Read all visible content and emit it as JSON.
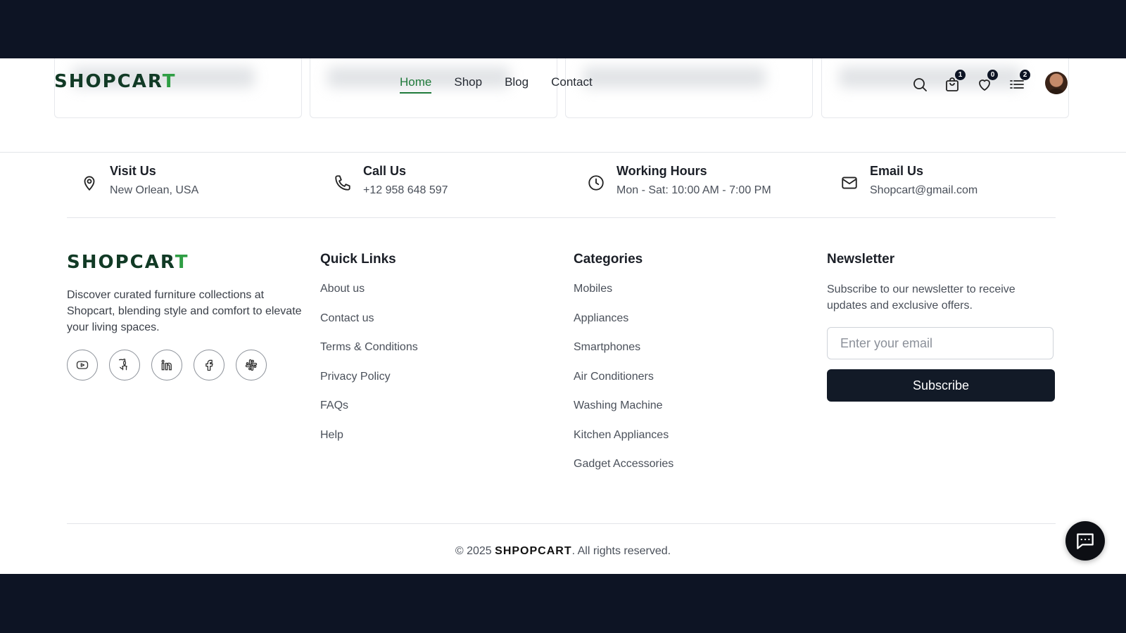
{
  "header": {
    "logo_main": "SHOPCAR",
    "logo_accent": "T",
    "nav": [
      "Home",
      "Shop",
      "Blog",
      "Contact"
    ],
    "active_nav": "Home",
    "badges": {
      "cart": "1",
      "wishlist": "0",
      "compare": "2"
    }
  },
  "contact": {
    "visit": {
      "title": "Visit Us",
      "text": "New Orlean, USA"
    },
    "call": {
      "title": "Call Us",
      "text": "+12 958 648 597"
    },
    "hours": {
      "title": "Working Hours",
      "text": "Mon - Sat: 10:00 AM - 7:00 PM"
    },
    "email": {
      "title": "Email Us",
      "text": "Shopcart@gmail.com"
    }
  },
  "brand": {
    "logo_main": "SHOPCAR",
    "logo_accent": "T",
    "description": "Discover curated furniture collections at Shopcart, blending style and comfort to elevate your living spaces.",
    "socials": [
      "youtube-icon",
      "github-icon",
      "linkedin-icon",
      "facebook-icon",
      "slack-icon"
    ]
  },
  "quick_links": {
    "title": "Quick Links",
    "items": [
      "About us",
      "Contact us",
      "Terms & Conditions",
      "Privacy Policy",
      "FAQs",
      "Help"
    ]
  },
  "categories": {
    "title": "Categories",
    "items": [
      "Mobiles",
      "Appliances",
      "Smartphones",
      "Air Conditioners",
      "Washing Machine",
      "Kitchen Appliances",
      "Gadget Accessories"
    ]
  },
  "newsletter": {
    "title": "Newsletter",
    "description": "Subscribe to our newsletter to receive updates and exclusive offers.",
    "placeholder": "Enter your email",
    "button": "Subscribe"
  },
  "footer": {
    "copyright_prefix": "© 2025",
    "brand": "SHPOPCART",
    "copyright_suffix": ". All rights reserved."
  },
  "colors": {
    "brand_dark": "#113a25",
    "brand_accent": "#2f9e44",
    "frame": "#0d1424",
    "button": "#121a27"
  }
}
